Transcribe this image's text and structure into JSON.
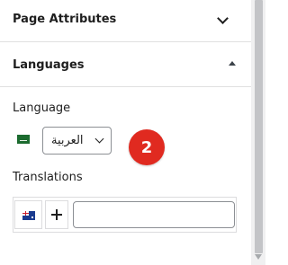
{
  "page_attributes": {
    "title": "Page Attributes",
    "icon": "chevron-down-icon"
  },
  "languages": {
    "title": "Languages",
    "toggle_icon": "caret-up-icon",
    "language_label": "Language",
    "language_flag": "saudi-arabia-flag-icon",
    "language_value": "العربية",
    "translations_label": "Translations",
    "translation_flag": "australia-flag-icon",
    "translation_input": {
      "value": "",
      "placeholder": ""
    }
  },
  "annotation_badge": "2",
  "colors": {
    "badge": "#e02a20",
    "text": "#1e1e1e",
    "border": "#8c8f94"
  }
}
